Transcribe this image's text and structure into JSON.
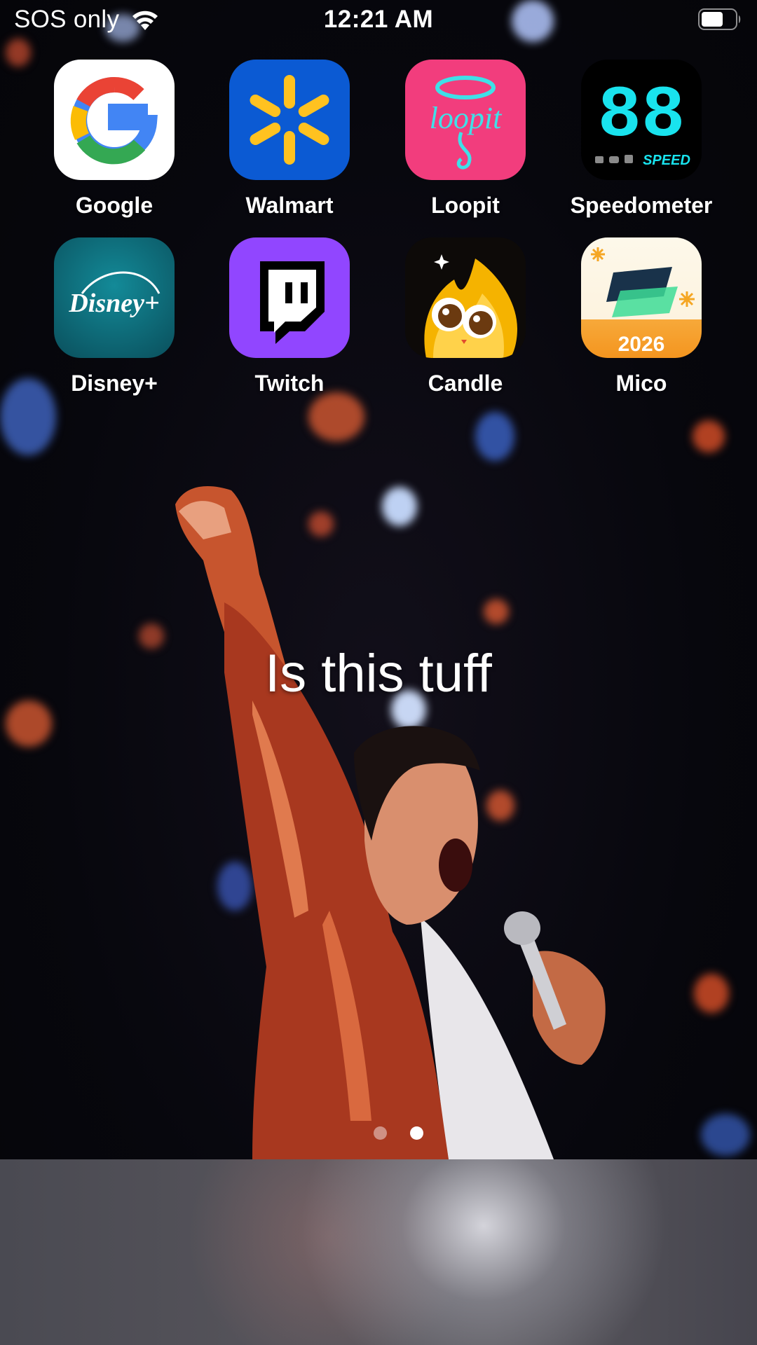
{
  "status_bar": {
    "carrier": "SOS only",
    "time": "12:21 AM",
    "icons": [
      "wifi-icon",
      "battery-icon"
    ]
  },
  "apps": [
    {
      "label": "Google",
      "icon": "google-icon",
      "color": "#ffffff"
    },
    {
      "label": "Walmart",
      "icon": "walmart-spark-icon",
      "color": "#0b5ad3"
    },
    {
      "label": "Loopit",
      "icon": "loopit-icon",
      "color": "#f23d7d"
    },
    {
      "label": "Speedometer",
      "icon": "speedometer-icon",
      "color": "#000000"
    },
    {
      "label": "Disney+",
      "icon": "disney-plus-icon",
      "color": "#0c6b78"
    },
    {
      "label": "Twitch",
      "icon": "twitch-icon",
      "color": "#9146ff"
    },
    {
      "label": "Candle",
      "icon": "candle-flame-icon",
      "color": "#f5b300"
    },
    {
      "label": "Mico",
      "icon": "mico-icon",
      "color": "#fdf6e6"
    }
  ],
  "icon_text": {
    "speedometer_digits": "88",
    "speedometer_word": "SPEED",
    "disney_wordmark": "Disney+",
    "loopit_wordmark": "loopit",
    "mico_year": "2026"
  },
  "caption": "Is this tuff",
  "page_indicator": {
    "total": 2,
    "current": 2
  },
  "accent_colors": {
    "text": "#ffffff",
    "wallpaper_bg": "#06070d"
  }
}
